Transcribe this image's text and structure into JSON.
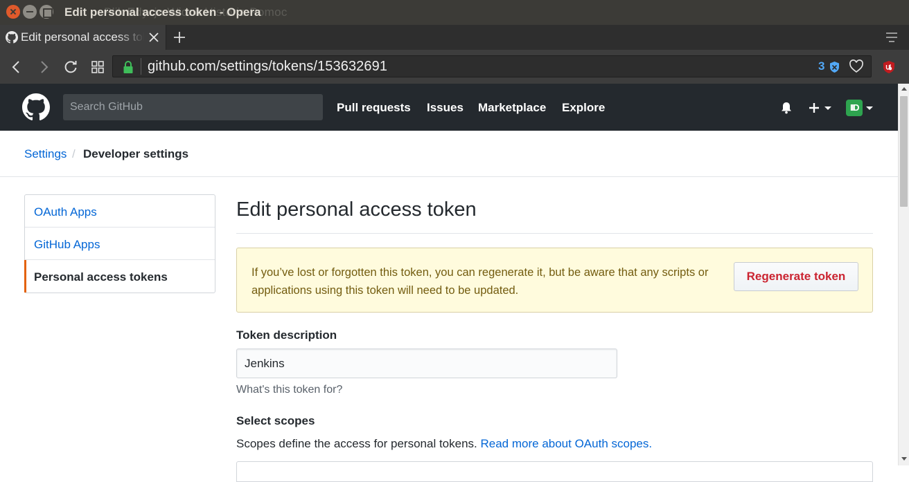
{
  "window": {
    "title": "Edit personal access token - Opera",
    "ghost_menu": "Plik  Edycja  Widok  Historia  Pomoc"
  },
  "browser": {
    "tab_title": "Edit personal access token",
    "url": "github.com/settings/tokens/153632691",
    "tracker_count": "3"
  },
  "header": {
    "search_placeholder": "Search GitHub",
    "nav": [
      "Pull requests",
      "Issues",
      "Marketplace",
      "Explore"
    ],
    "avatar_initials": "IID"
  },
  "breadcrumb": {
    "settings": "Settings",
    "separator": "/",
    "current": "Developer settings"
  },
  "menu": {
    "items": [
      {
        "label": "OAuth Apps"
      },
      {
        "label": "GitHub Apps"
      },
      {
        "label": "Personal access tokens",
        "selected": true
      }
    ]
  },
  "main": {
    "title": "Edit personal access token",
    "flash_text": "If you’ve lost or forgotten this token, you can regenerate it, but be aware that any scripts or applications using this token will need to be updated.",
    "regenerate_label": "Regenerate token",
    "token_description_label": "Token description",
    "token_description_value": "Jenkins",
    "token_description_note": "What's this token for?",
    "select_scopes_label": "Select scopes",
    "scopes_text": "Scopes define the access for personal tokens.",
    "scopes_link": "Read more about OAuth scopes."
  },
  "colors": {
    "github_header": "#24292e",
    "link": "#0366d6",
    "danger": "#cb2431",
    "flash_bg": "#fffbdd",
    "menu_selected_accent": "#e36209"
  },
  "icons": [
    "close-icon",
    "minimize-icon",
    "maximize-icon",
    "github-favicon-icon",
    "tab-close-icon",
    "plus-icon",
    "tab-menu-icon",
    "back-icon",
    "forward-icon",
    "reload-icon",
    "speed-dial-icon",
    "lock-icon",
    "tracker-shield-icon",
    "heart-icon",
    "ublock-icon",
    "github-logo-icon",
    "bell-icon",
    "caret-down-icon"
  ]
}
